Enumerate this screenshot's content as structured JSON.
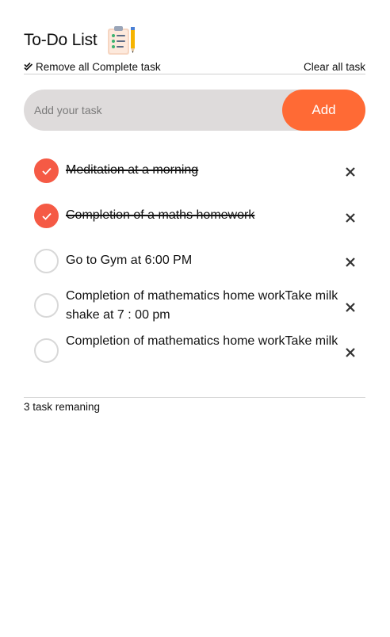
{
  "header": {
    "title": "To-Do List",
    "logo_icon": "checklist-pencil-icon"
  },
  "actions": {
    "remove_complete_label": "Remove all Complete task",
    "clear_all_label": "Clear all task"
  },
  "input": {
    "placeholder": "Add your task",
    "value": "",
    "add_label": "Add"
  },
  "tasks": [
    {
      "text": "Meditation at a morning",
      "completed": true
    },
    {
      "text": "Completion of a maths homework",
      "completed": true
    },
    {
      "text": "Go to Gym at 6:00 PM",
      "completed": false
    },
    {
      "text": "Completion of mathematics home workTake milk shake at 7 : 00 pm",
      "completed": false
    },
    {
      "text": "Completion of mathematics home workTake milk",
      "completed": false
    }
  ],
  "footer": {
    "remaining": "3 task remaning"
  },
  "colors": {
    "accent": "#ff6a35",
    "check_done": "#f55a45",
    "input_bg": "#dedbdb"
  }
}
